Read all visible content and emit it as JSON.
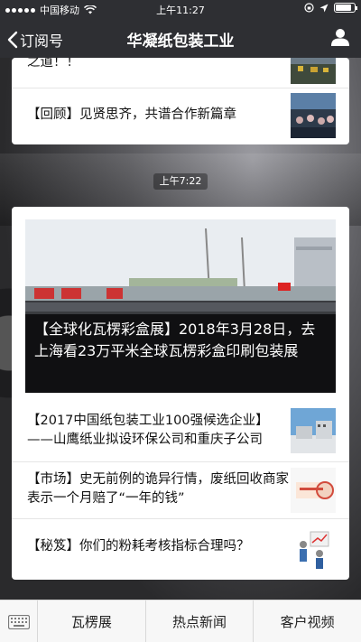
{
  "status": {
    "carrier": "中国移动",
    "time": "上午11:27"
  },
  "nav": {
    "back_label": "订阅号",
    "title": "华凝纸包装工业"
  },
  "card1": {
    "partial_text": "之道！！",
    "item": "【回顾】见贤思齐，共谱合作新篇章"
  },
  "time_chip": "上午7:22",
  "card2": {
    "hero_caption": "【全球化瓦楞彩盒展】2018年3月28日，去上海看23万平米全球瓦楞彩盒印刷包装展",
    "items": [
      {
        "text": "【2017中国纸包装工业100强候选企业】——山鹰纸业拟设环保公司和重庆子公司"
      },
      {
        "text": "【市场】史无前例的诡异行情，废纸回收商家表示一个月赔了“一年的钱”"
      },
      {
        "text": "【秘笈】你们的粉耗考核指标合理吗？"
      }
    ]
  },
  "tabbar": {
    "tabs": [
      "瓦楞展",
      "热点新闻",
      "客户视频"
    ]
  }
}
